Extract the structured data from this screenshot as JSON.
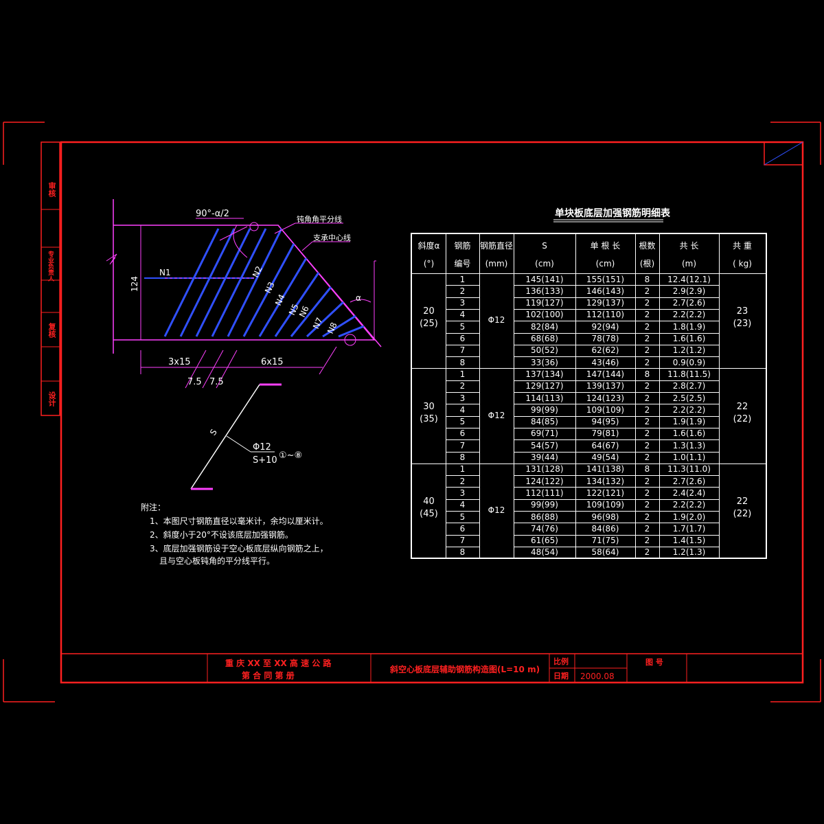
{
  "sheet": {
    "title_block": {
      "project_line1": "重 庆 XX 至 XX 高 速 公 路",
      "project_line2": "第   合 同 第      册",
      "drawing_title": "斜空心板底层辅助钢筋构造图(L=10 m)",
      "scale_label": "比例",
      "date_label": "日期",
      "date_value": "2000.08",
      "drawing_no_label": "图   号"
    },
    "side_labels": [
      "审核",
      "专业负责人",
      "复核",
      "设计"
    ]
  },
  "drawing": {
    "angle_label": "90°-α/2",
    "bisector_label": "钝角角平分线",
    "support_label": "支承中心线",
    "height_dim": "124",
    "bar_labels": [
      "N1",
      "N2",
      "N3",
      "N4",
      "N5",
      "N6",
      "N7",
      "N8"
    ],
    "dim_left": "3x15",
    "dim_right": "6x15",
    "dim_small_1": "7.5",
    "dim_small_2": "7.5",
    "alpha_mark": "α"
  },
  "detail": {
    "s_label": "S",
    "dia_label": "Φ12",
    "len_label": "S+10",
    "range_label": "①~⑧"
  },
  "notes": {
    "heading": "附注：",
    "items": [
      "1、本图尺寸钢筋直径以毫米计，余均以厘米计。",
      "2、斜度小于20°不设该底层加强钢筋。",
      "3、底层加强钢筋设于空心板底层纵向钢筋之上，",
      "且与空心板钝角的平分线平行。"
    ]
  },
  "table": {
    "title": "单块板底层加强钢筋明细表",
    "headers": [
      [
        "斜度α",
        "(°)"
      ],
      [
        "钢筋",
        "编号"
      ],
      [
        "钢筋直径",
        "(mm)"
      ],
      [
        "S",
        "(cm)"
      ],
      [
        "单 根 长",
        "(cm)"
      ],
      [
        "根数",
        "(根)"
      ],
      [
        "共   长",
        "(m)"
      ],
      [
        "共   重",
        "( kg)"
      ]
    ],
    "groups": [
      {
        "angle": "20",
        "angle_alt": "(25)",
        "dia": "Φ12",
        "weight": "23",
        "weight_alt": "(23)",
        "rows": [
          [
            "1",
            "145(141)",
            "155(151)",
            "8",
            "12.4(12.1)"
          ],
          [
            "2",
            "136(133)",
            "146(143)",
            "2",
            "2.9(2.9)"
          ],
          [
            "3",
            "119(127)",
            "129(137)",
            "2",
            "2.7(2.6)"
          ],
          [
            "4",
            "102(100)",
            "112(110)",
            "2",
            "2.2(2.2)"
          ],
          [
            "5",
            "82(84)",
            "92(94)",
            "2",
            "1.8(1.9)"
          ],
          [
            "6",
            "68(68)",
            "78(78)",
            "2",
            "1.6(1.6)"
          ],
          [
            "7",
            "50(52)",
            "62(62)",
            "2",
            "1.2(1.2)"
          ],
          [
            "8",
            "33(36)",
            "43(46)",
            "2",
            "0.9(0.9)"
          ]
        ]
      },
      {
        "angle": "30",
        "angle_alt": "(35)",
        "dia": "Φ12",
        "weight": "22",
        "weight_alt": "(22)",
        "rows": [
          [
            "1",
            "137(134)",
            "147(144)",
            "8",
            "11.8(11.5)"
          ],
          [
            "2",
            "129(127)",
            "139(137)",
            "2",
            "2.8(2.7)"
          ],
          [
            "3",
            "114(113)",
            "124(123)",
            "2",
            "2.5(2.5)"
          ],
          [
            "4",
            "99(99)",
            "109(109)",
            "2",
            "2.2(2.2)"
          ],
          [
            "5",
            "84(85)",
            "94(95)",
            "2",
            "1.9(1.9)"
          ],
          [
            "6",
            "69(71)",
            "79(81)",
            "2",
            "1.6(1.6)"
          ],
          [
            "7",
            "54(57)",
            "64(67)",
            "2",
            "1.3(1.3)"
          ],
          [
            "8",
            "39(44)",
            "49(54)",
            "2",
            "1.0(1.1)"
          ]
        ]
      },
      {
        "angle": "40",
        "angle_alt": "(45)",
        "dia": "Φ12",
        "weight": "22",
        "weight_alt": "(22)",
        "rows": [
          [
            "1",
            "131(128)",
            "141(138)",
            "8",
            "11.3(11.0)"
          ],
          [
            "2",
            "124(122)",
            "134(132)",
            "2",
            "2.7(2.6)"
          ],
          [
            "3",
            "112(111)",
            "122(121)",
            "2",
            "2.4(2.4)"
          ],
          [
            "4",
            "99(99)",
            "109(109)",
            "2",
            "2.2(2.2)"
          ],
          [
            "5",
            "86(88)",
            "96(98)",
            "2",
            "1.9(2.0)"
          ],
          [
            "6",
            "74(76)",
            "84(86)",
            "2",
            "1.7(1.7)"
          ],
          [
            "7",
            "61(65)",
            "71(75)",
            "2",
            "1.4(1.5)"
          ],
          [
            "8",
            "48(54)",
            "58(64)",
            "2",
            "1.2(1.3)"
          ]
        ]
      }
    ]
  }
}
